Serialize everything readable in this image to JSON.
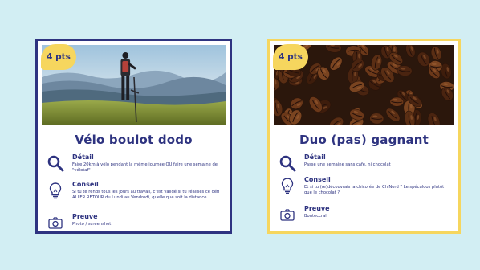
{
  "cards": [
    {
      "badge": "4 pts",
      "title": "Vélo boulot dodo",
      "sections": [
        {
          "icon": "magnifier-icon",
          "heading": "Détail",
          "text": "Faire 20km à vélo pendant la même journée OU faire une semaine de \"vélotaf\""
        },
        {
          "icon": "lightbulb-icon",
          "heading": "Conseil",
          "text": "Si tu te rends tous les jours au travail, c'est validé si tu réalises ce défi ALLER RETOUR du Lundi au Vendredi, quelle que soit la distance"
        },
        {
          "icon": "camera-icon",
          "heading": "Preuve",
          "text": "Photo / screenshot"
        }
      ]
    },
    {
      "badge": "4 pts",
      "title": "Duo (pas) gagnant",
      "sections": [
        {
          "icon": "magnifier-icon",
          "heading": "Détail",
          "text": "Passe une semaine sans café, ni chocolat !"
        },
        {
          "icon": "lightbulb-icon",
          "heading": "Conseil",
          "text": "Et si tu (re)découvrais la chicorée de Ch'Nord ? Le spéculoos plutôt que le chocolat ?"
        },
        {
          "icon": "camera-icon",
          "heading": "Preuve",
          "text": "Bonteccrall"
        }
      ]
    }
  ],
  "colors": {
    "background": "#d2eef3",
    "navy": "#2e3380",
    "yellow": "#f6d65e"
  }
}
